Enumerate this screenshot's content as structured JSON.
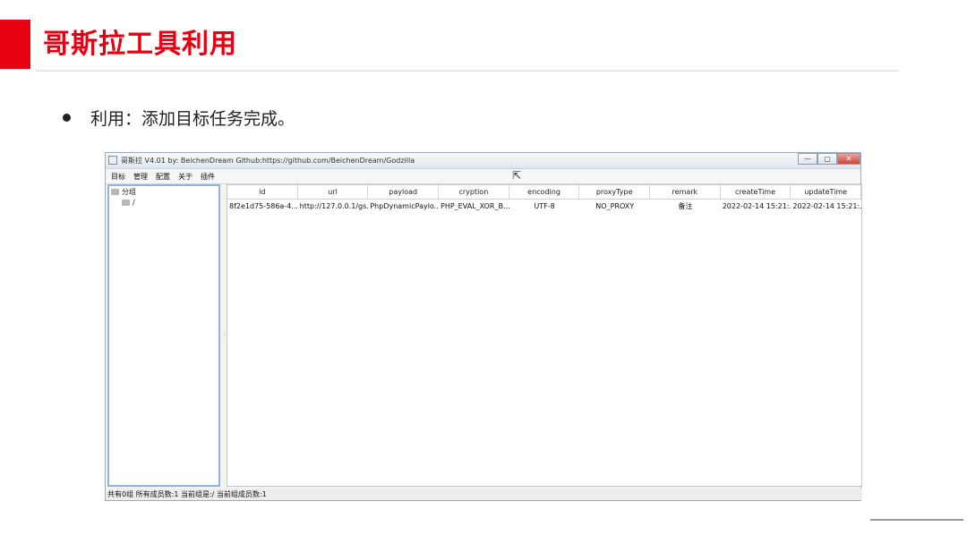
{
  "slide": {
    "title": "哥斯拉工具利用",
    "bullet": "利用：添加目标任务完成。"
  },
  "colors": {
    "accent": "#e60012",
    "sidebar_border": "#8eb4de"
  },
  "window": {
    "title": "哥斯拉   V4.01 by: BeichenDream Github:https://github.com/BeichenDream/Godzilla",
    "controls": [
      "—",
      "▢",
      "✕"
    ],
    "menu": [
      "目标",
      "管理",
      "配置",
      "关于",
      "插件"
    ],
    "tree": {
      "root": "分组",
      "child": "/"
    },
    "columns": [
      "id",
      "url",
      "payload",
      "cryption",
      "encoding",
      "proxyType",
      "remark",
      "createTime",
      "updateTime"
    ],
    "rows": [
      [
        "8f2e1d75-586a-4...",
        "http://127.0.0.1/gs...",
        "PhpDynamicPaylo...",
        "PHP_EVAL_XOR_B...",
        "UTF-8",
        "NO_PROXY",
        "备注",
        "2022-02-14 15:21:...",
        "2022-02-14 15:21:..."
      ]
    ],
    "status": "共有0组 所有成员数:1 当前组是:/ 当前组成员数:1",
    "icons": {
      "app": "app-window-icon",
      "cursor": "mouse-cursor-icon",
      "folder": "folder-icon"
    }
  }
}
